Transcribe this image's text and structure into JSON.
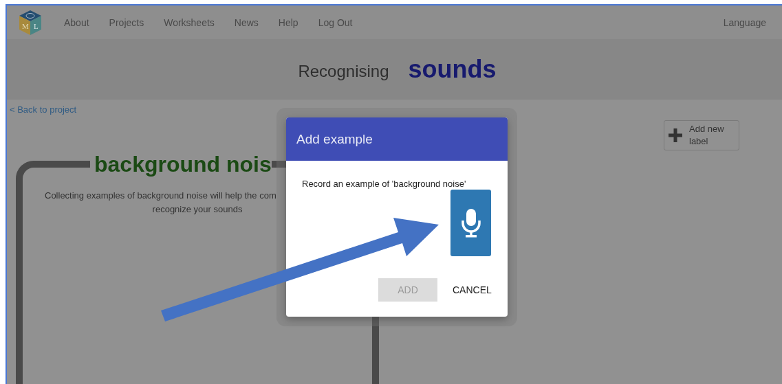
{
  "nav": {
    "logo_letters": [
      "M",
      "L"
    ],
    "items": [
      {
        "label": "About"
      },
      {
        "label": "Projects"
      },
      {
        "label": "Worksheets"
      },
      {
        "label": "News"
      },
      {
        "label": "Help"
      },
      {
        "label": "Log Out"
      }
    ],
    "language": "Language"
  },
  "header": {
    "title_prefix": "Recognising",
    "title_main": "sounds"
  },
  "back_link": "< Back to project",
  "add_label_button": "Add new label",
  "card": {
    "heading": "background nois",
    "description_lines": [
      "Collecting examples of background noise will help the com",
      "recognize your sounds"
    ]
  },
  "dialog": {
    "title": "Add example",
    "prompt": "Record an example of 'background noise'",
    "buttons": [
      {
        "label": "ADD",
        "disabled": true
      },
      {
        "label": "CANCEL",
        "disabled": false
      }
    ]
  }
}
